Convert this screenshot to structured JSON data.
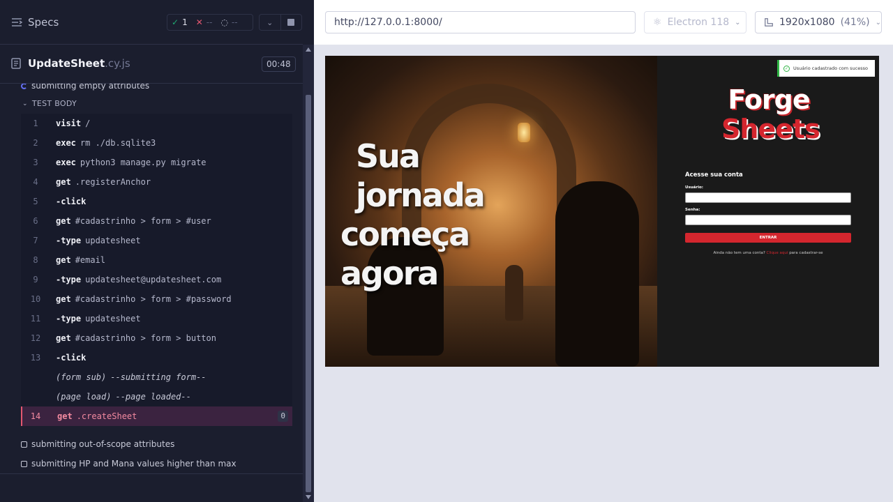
{
  "reporter": {
    "specs_label": "Specs",
    "stats": {
      "passed": "1",
      "failed": "--",
      "pending": "--"
    },
    "file": {
      "name": "UpdateSheet",
      "ext": ".cy.js",
      "duration": "00:48"
    },
    "current_test": "submitting empty attributes",
    "test_body_label": "TEST BODY",
    "commands": [
      {
        "n": "1",
        "name": "visit",
        "arg": "/"
      },
      {
        "n": "2",
        "name": "exec",
        "arg": "rm ./db.sqlite3"
      },
      {
        "n": "3",
        "name": "exec",
        "arg": "python3 manage.py migrate"
      },
      {
        "n": "4",
        "name": "get",
        "arg": ".registerAnchor"
      },
      {
        "n": "5",
        "name": "-click",
        "arg": ""
      },
      {
        "n": "6",
        "name": "get",
        "arg": "#cadastrinho > form > #user"
      },
      {
        "n": "7",
        "name": "-type",
        "arg": "updatesheet"
      },
      {
        "n": "8",
        "name": "get",
        "arg": "#email"
      },
      {
        "n": "9",
        "name": "-type",
        "arg": "updatesheet@updatesheet.com"
      },
      {
        "n": "10",
        "name": "get",
        "arg": "#cadastrinho > form > #password"
      },
      {
        "n": "11",
        "name": "-type",
        "arg": "updatesheet"
      },
      {
        "n": "12",
        "name": "get",
        "arg": "#cadastrinho > form > button"
      },
      {
        "n": "13",
        "name": "-click",
        "arg": ""
      },
      {
        "n": "",
        "name": "(form sub)",
        "arg": "--submitting form--"
      },
      {
        "n": "",
        "name": "(page load)",
        "arg": "--page loaded--"
      },
      {
        "n": "14",
        "name": "get",
        "arg": ".createSheet",
        "badge": "0"
      }
    ],
    "other_tests": [
      "submitting out-of-scope attributes",
      "submitting HP and Mana values higher than max"
    ]
  },
  "aut": {
    "url": "http://127.0.0.1:8000/",
    "browser": "Electron 118",
    "viewport": "1920x1080",
    "viewport_scale": "(41%)"
  },
  "app": {
    "hero_line1": "Sua jornada",
    "hero_line2": "começa agora",
    "toast": "Usuário cadastrado com sucesso",
    "logo_line1": "Forge",
    "logo_line2": "Sheets",
    "login_title": "Acesse sua conta",
    "user_label": "Usuário:",
    "password_label": "Senha:",
    "submit_label": "ENTRAR",
    "signup_prefix": "Ainda não tem uma conta?",
    "signup_link": "Clique aqui",
    "signup_suffix": "para cadastrar-se"
  },
  "colors": {
    "pass": "#1fa971",
    "fail": "#e45770",
    "accent": "#d4262e",
    "running": "#6470f3"
  }
}
